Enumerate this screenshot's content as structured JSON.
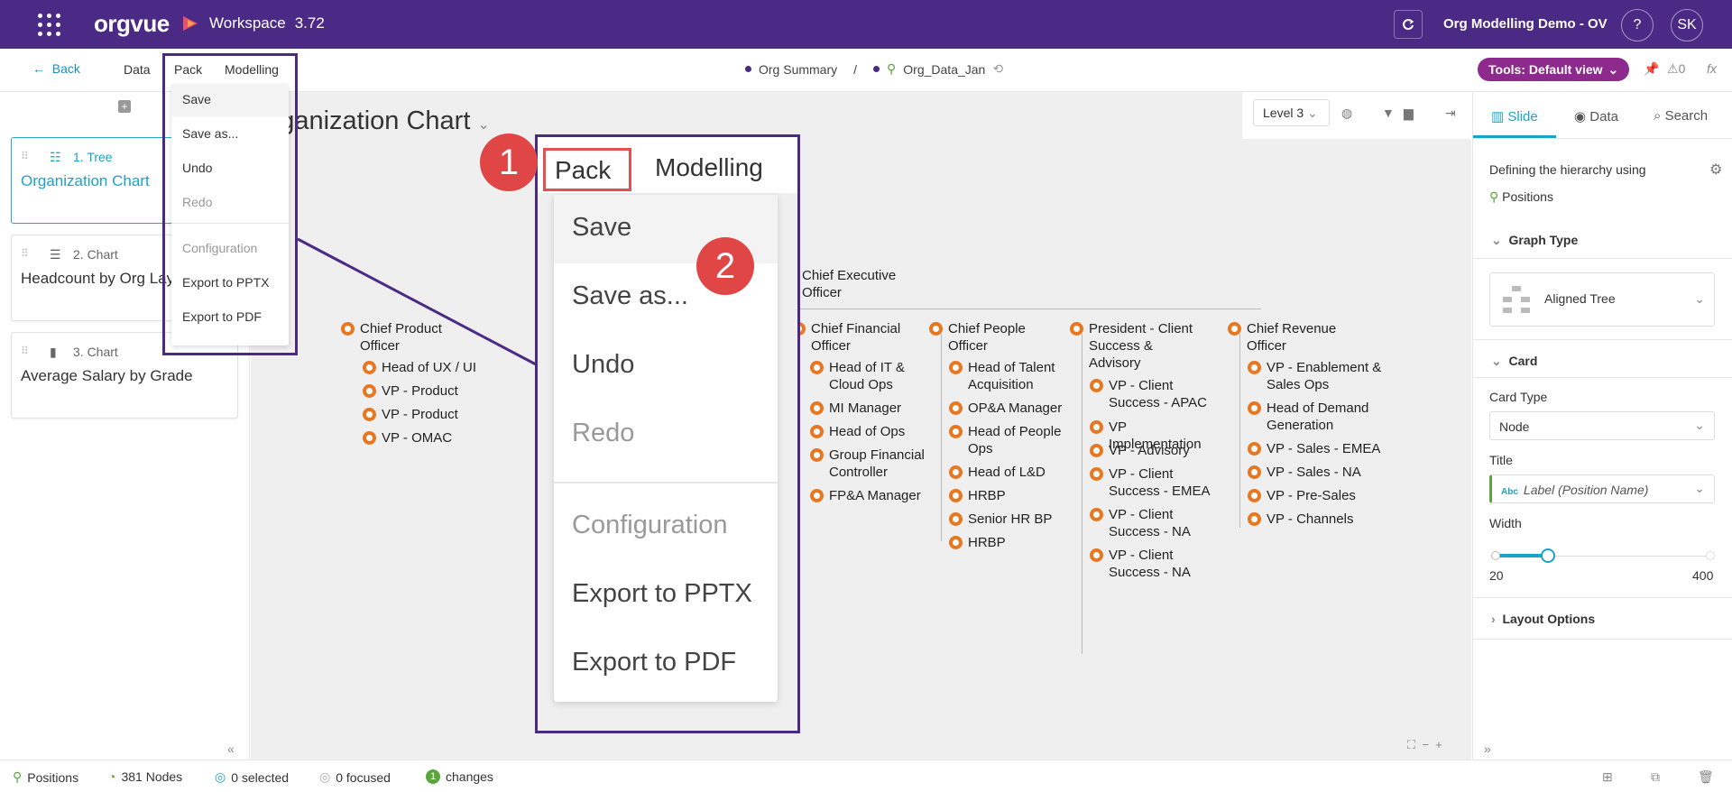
{
  "topbar": {
    "logo": "orgvue",
    "workspace_label": "Workspace",
    "version": "3.72",
    "project_name": "Org Modelling Demo - OV",
    "help": "?",
    "user_initials": "SK"
  },
  "subbar": {
    "back_label": "Back",
    "menus": [
      "Data",
      "Pack",
      "Modelling"
    ],
    "breadcrumb": [
      "Org Summary",
      "Org_Data_Jan"
    ],
    "breadcrumb_sep": "/",
    "tools_label": "Tools: Default view",
    "alert_count": "0"
  },
  "pack_menu": {
    "items": [
      "Save",
      "Save as...",
      "Undo",
      "Redo",
      "Configuration",
      "Export to PPTX",
      "Export to PDF"
    ]
  },
  "slides": [
    {
      "kind": "1. Tree",
      "title": "Organization Chart"
    },
    {
      "kind": "2. Chart",
      "title": "Headcount by Org Layer"
    },
    {
      "kind": "3. Chart",
      "title": "Average Salary by Grade"
    }
  ],
  "canvas": {
    "title": "Organization Chart",
    "level": "Level 3",
    "ceo": "Chief Executive Officer",
    "columns": [
      {
        "head": "Chief Product Officer",
        "reports": [
          "Head of UX / UI",
          "VP - Product",
          "VP - Product",
          "VP - OMAC"
        ]
      },
      {
        "head": "Chief Financial Officer",
        "reports": [
          "Head of IT & Cloud Ops",
          "MI Manager",
          "Head of Ops",
          "Group Financial Controller",
          "FP&A Manager"
        ]
      },
      {
        "head": "Chief People Officer",
        "reports": [
          "Head of Talent Acquisition",
          "OP&A Manager",
          "Head of People Ops",
          "Head of L&D",
          "HRBP",
          "Senior HR BP",
          "HRBP"
        ]
      },
      {
        "head": "President -  Client Success & Advisory",
        "reports": [
          "VP - Client Success - APAC",
          "VP Implementation",
          "VP - Advisory",
          "VP - Client Success - EMEA",
          "VP - Client Success - NA",
          "VP - Client Success - NA"
        ]
      },
      {
        "head": "Chief Revenue Officer",
        "reports": [
          "VP - Enablement & Sales Ops",
          "Head of Demand Generation",
          "VP - Sales - EMEA",
          "VP - Sales - NA",
          "VP - Pre-Sales",
          "VP - Channels"
        ]
      }
    ]
  },
  "zoom_callout": {
    "pack": "Pack",
    "modelling": "Modelling",
    "badge1": "1",
    "badge2": "2"
  },
  "right_panel": {
    "tabs": [
      "Slide",
      "Data",
      "Search"
    ],
    "hierarchy_text": "Defining the hierarchy using",
    "hierarchy_value": "Positions",
    "graph_type_section": "Graph Type",
    "graph_type_value": "Aligned Tree",
    "card_section": "Card",
    "card_type_label": "Card Type",
    "card_type_value": "Node",
    "title_label": "Title",
    "title_value": "Label (Position Name)",
    "title_abc": "Abc",
    "width_label": "Width",
    "width_min": "20",
    "width_max": "400",
    "width_fraction": 0.24,
    "layout_section": "Layout Options"
  },
  "statusbar": {
    "positions": "Positions",
    "nodes": "381 Nodes",
    "selected": "0 selected",
    "focused": "0 focused",
    "changes_count": "1",
    "changes": "changes"
  },
  "colors": {
    "topbar": "#4b2a86",
    "accent": "#1aa4c6",
    "node": "#e87722",
    "tools": "#8e2a8e",
    "badge": "#e04646"
  }
}
